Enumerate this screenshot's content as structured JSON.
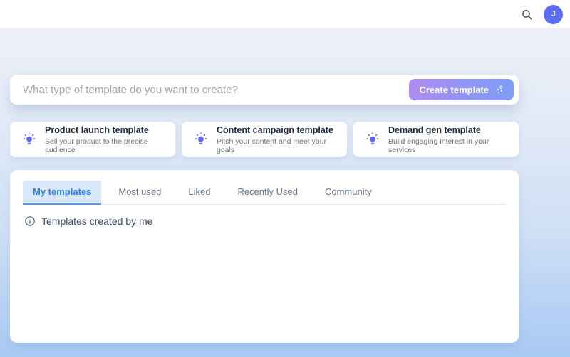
{
  "header": {
    "search_icon": "search-icon",
    "avatar_initial": "J"
  },
  "prompt_bar": {
    "placeholder": "What type of template do you want to create?",
    "create_button_label": "Create template",
    "create_button_icon": "sparkles-icon",
    "button_gradient": [
      "#b18cf2",
      "#7e9ef4"
    ]
  },
  "suggestion_cards": [
    {
      "icon": "lightbulb-icon",
      "title": "Product launch template",
      "subtitle": "Sell your product to the precise audience"
    },
    {
      "icon": "lightbulb-icon",
      "title": "Content campaign template",
      "subtitle": "Pitch your content and meet your goals"
    },
    {
      "icon": "lightbulb-icon",
      "title": "Demand gen template",
      "subtitle": "Build engaging interest in your services"
    }
  ],
  "templates_panel": {
    "tabs": [
      {
        "label": "My templates",
        "active": true
      },
      {
        "label": "Most used",
        "active": false
      },
      {
        "label": "Liked",
        "active": false
      },
      {
        "label": "Recently Used",
        "active": false
      },
      {
        "label": "Community",
        "active": false
      }
    ],
    "empty_state": "Templates created by me"
  },
  "colors": {
    "avatar_bg": "#5b6cf0",
    "active_tab_bg": "#d8e8fa",
    "active_tab_text": "#2e7ce0",
    "active_tab_underline": "#5c96dd",
    "accent_icon": "#6366f1",
    "page_gradient_top": "#f0f2f9",
    "page_gradient_bottom": "#a7c9f3"
  }
}
